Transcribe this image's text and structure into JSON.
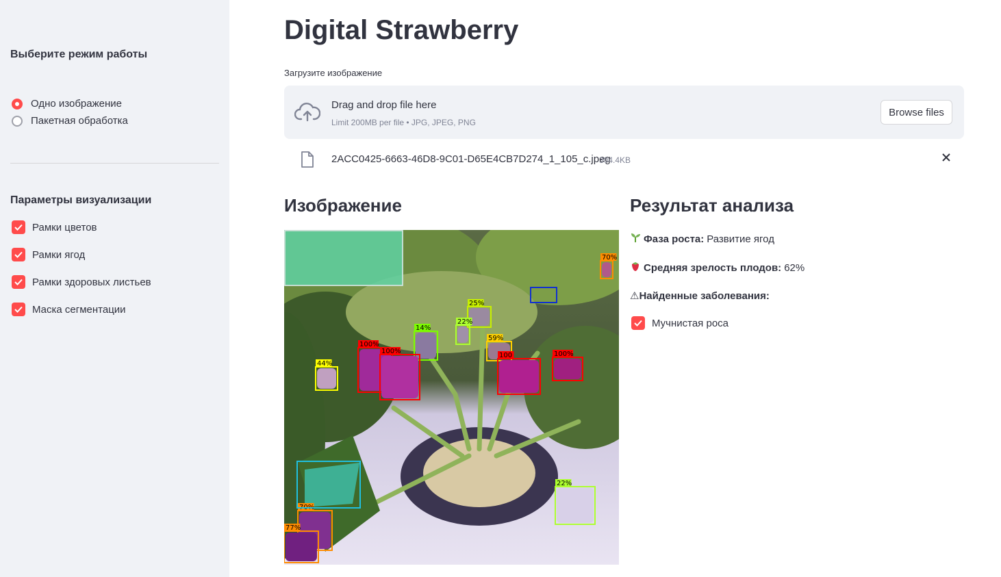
{
  "sidebar": {
    "mode_heading": "Выберите режим работы",
    "modes": [
      {
        "label": "Одно изображение",
        "selected": true
      },
      {
        "label": "Пакетная обработка",
        "selected": false
      }
    ],
    "viz_heading": "Параметры визуализации",
    "viz_options": [
      {
        "label": "Рамки цветов",
        "checked": true
      },
      {
        "label": "Рамки ягод",
        "checked": true
      },
      {
        "label": "Рамки здоровых листьев",
        "checked": true
      },
      {
        "label": "Маска сегментации",
        "checked": true
      }
    ]
  },
  "main": {
    "title": "Digital Strawberry",
    "upload": {
      "label": "Загрузите изображение",
      "drop_text": "Drag and drop file here",
      "limit_text": "Limit 200MB per file • JPG, JPEG, PNG",
      "browse_label": "Browse files"
    },
    "file": {
      "name": "2ACC0425-6663-46D8-9C01-D65E4CB7D274_1_105_c.jpeg",
      "size": "304.4KB"
    },
    "image_heading": "Изображение",
    "results_heading": "Результат анализа",
    "detections": [
      {
        "label": "70%",
        "color": "#ff8c00"
      },
      {
        "label": "25%",
        "color": "#c8f000"
      },
      {
        "label": "14%",
        "color": "#7cfc00"
      },
      {
        "label": "22%",
        "color": "#adff2f"
      },
      {
        "label": "59%",
        "color": "#ffd000"
      },
      {
        "label": "100%",
        "color": "#ff0000"
      },
      {
        "label": "100%",
        "color": "#ff0000"
      },
      {
        "label": "44%",
        "color": "#ffff00"
      },
      {
        "label": "100",
        "color": "#ff0000"
      },
      {
        "label": "100%",
        "color": "#ff0000"
      },
      {
        "label": "22%",
        "color": "#adff2f"
      },
      {
        "label": "70%",
        "color": "#ff8c00"
      },
      {
        "label": "77%",
        "color": "#ff8c00"
      }
    ],
    "results": {
      "phase_label": "Фаза роста:",
      "phase_value": "Развитие ягод",
      "ripeness_label": "Средняя зрелость плодов:",
      "ripeness_value": "62%",
      "diseases_label": "⚠Найденные заболевания:",
      "diseases": [
        {
          "label": "Мучнистая роса",
          "checked": true
        }
      ]
    }
  }
}
